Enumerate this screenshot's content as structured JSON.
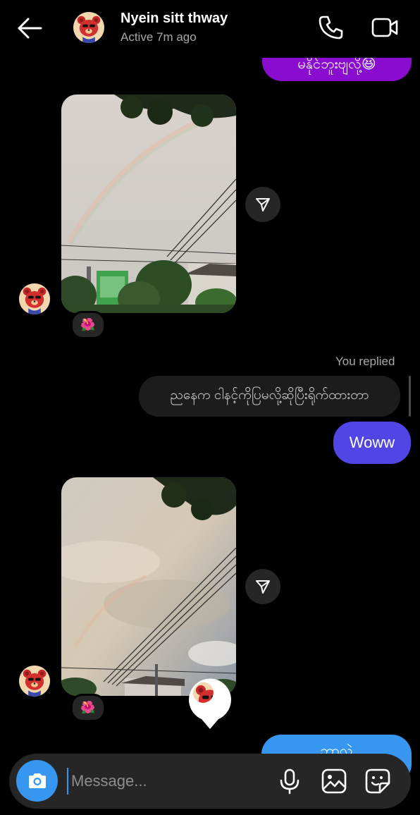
{
  "header": {
    "contact_name": "Nyein sitt thway",
    "status": "Active 7m ago"
  },
  "messages": {
    "top_sent_text": "မနိုင်ဘူးဗျလို့😆",
    "photo1_reaction": "🌺",
    "replied_label": "You replied",
    "quoted_text": "ညနေက ငါနင့်ကိုပြမလို့ဆိုပြီးရိုက်ထားတာ",
    "reply_text": "Woww",
    "photo2_reaction": "🌺",
    "bottom_sent_text": "ဘာလဲ"
  },
  "composer": {
    "placeholder": "Message..."
  },
  "icons": [
    "back-arrow-icon",
    "phone-icon",
    "video-camera-icon",
    "send-icon",
    "camera-icon",
    "microphone-icon",
    "gallery-icon",
    "sticker-icon"
  ],
  "colors": {
    "sent_purple": "#8a0ccf",
    "sent_blue": "#4f46e5",
    "received_gray": "#262626",
    "accent": "#3797f0"
  }
}
